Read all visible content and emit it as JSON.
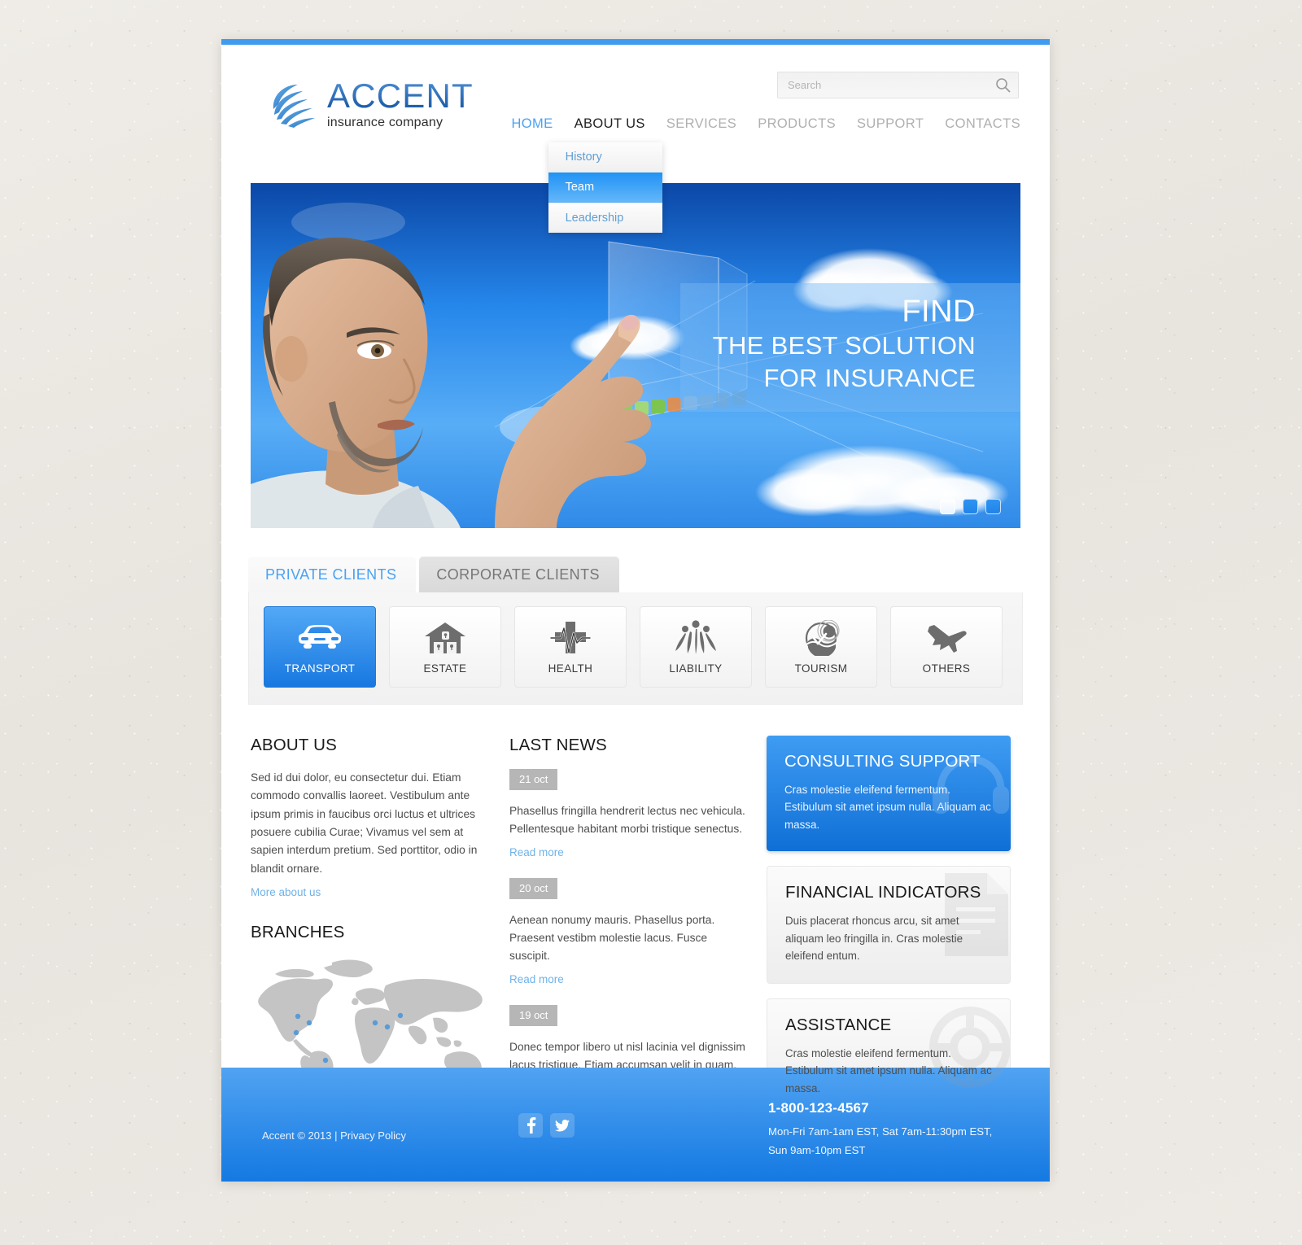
{
  "search": {
    "placeholder": "Search",
    "value": "",
    "icon": "search-icon"
  },
  "logo": {
    "name": "ACCENT",
    "tagline": "insurance company",
    "icon": "globe-swoosh-logo"
  },
  "nav": {
    "items": [
      {
        "label": "HOME",
        "state": "active"
      },
      {
        "label": "ABOUT US",
        "state": "hover"
      },
      {
        "label": "SERVICES",
        "state": "idle"
      },
      {
        "label": "PRODUCTS",
        "state": "idle"
      },
      {
        "label": "SUPPORT",
        "state": "idle"
      },
      {
        "label": "CONTACTS",
        "state": "idle"
      }
    ],
    "dropdown": {
      "parent": "ABOUT US",
      "items": [
        {
          "label": "History",
          "selected": false
        },
        {
          "label": "Team",
          "selected": true
        },
        {
          "label": "Leadership",
          "selected": false
        }
      ]
    }
  },
  "slider": {
    "caption_line1": "FIND",
    "caption_line2": "THE BEST SOLUTION",
    "caption_line3": "FOR INSURANCE",
    "pager": [
      {
        "index": 1,
        "active": true
      },
      {
        "index": 2,
        "active": false
      },
      {
        "index": 3,
        "active": false
      }
    ]
  },
  "client_tabs": [
    {
      "label": "PRIVATE CLIENTS",
      "active": true
    },
    {
      "label": "CORPORATE CLIENTS",
      "active": false
    }
  ],
  "categories": [
    {
      "label": "TRANSPORT",
      "icon": "car-icon",
      "selected": true
    },
    {
      "label": "ESTATE",
      "icon": "house-lock-icon",
      "selected": false
    },
    {
      "label": "HEALTH",
      "icon": "heartbeat-cross-icon",
      "selected": false
    },
    {
      "label": "LIABILITY",
      "icon": "fountain-people-icon",
      "selected": false
    },
    {
      "label": "TOURISM",
      "icon": "globe-wave-icon",
      "selected": false
    },
    {
      "label": "OTHERS",
      "icon": "airplane-icon",
      "selected": false
    }
  ],
  "about": {
    "title": "ABOUT US",
    "text": "Sed id dui dolor, eu consectetur dui. Etiam commodo convallis laoreet. Vestibulum ante ipsum primis in faucibus orci luctus et ultrices posuere cubilia Curae; Vivamus vel sem at sapien interdum pretium. Sed porttitor, odio in blandit ornare.",
    "link": "More about us"
  },
  "branches": {
    "title": "BRANCHES",
    "marker_color": "#5b9bd5",
    "map_color": "#c4c4c4"
  },
  "news": {
    "title": "LAST NEWS",
    "read_more": "Read more",
    "items": [
      {
        "date": "21 oct",
        "text": "Phasellus fringilla hendrerit lectus nec vehicula. Pellentesque habitant morbi tristique senectus."
      },
      {
        "date": "20 oct",
        "text": "Aenean nonumy mauris. Phasellus porta. Praesent vestibm molestie lacus. Fusce suscipit."
      },
      {
        "date": "19 oct",
        "text": "Donec tempor libero ut nisl lacinia vel dignissim lacus tristique. Etiam accumsan velit in quam."
      }
    ]
  },
  "side_boxes": [
    {
      "title": "CONSULTING SUPPORT",
      "text": "Cras molestie eleifend fermentum. Estibulum sit amet ipsum nulla. Aliquam ac massa.",
      "style": "blue",
      "watermark": "headset-icon"
    },
    {
      "title": "FINANCIAL INDICATORS",
      "text": "Duis placerat rhoncus arcu, sit amet aliquam leo fringilla in. Cras molestie eleifend entum.",
      "style": "plain",
      "watermark": "document-icon"
    },
    {
      "title": "ASSISTANCE",
      "text": "Cras molestie eleifend fermentum. Estibulum sit amet ipsum nulla.  Aliquam ac massa.",
      "style": "plain",
      "watermark": "lifebuoy-icon"
    }
  ],
  "footer": {
    "copyright": "Accent © 2013 | ",
    "privacy": "Privacy Policy",
    "social": [
      {
        "name": "facebook",
        "glyph": "f"
      },
      {
        "name": "twitter",
        "glyph": "ᴠ"
      }
    ],
    "phone": "1-800-123-4567",
    "hours_line1": "Mon-Fri 7am-1am EST, Sat 7am-11:30pm EST,",
    "hours_line2": "Sun 9am-10pm EST"
  },
  "colors": {
    "accent": "#3f9bf0",
    "link": "#6fb2e8",
    "nav_active": "#4ba2f2",
    "footer_top": "#51a3f2",
    "footer_bottom": "#1479e2"
  }
}
